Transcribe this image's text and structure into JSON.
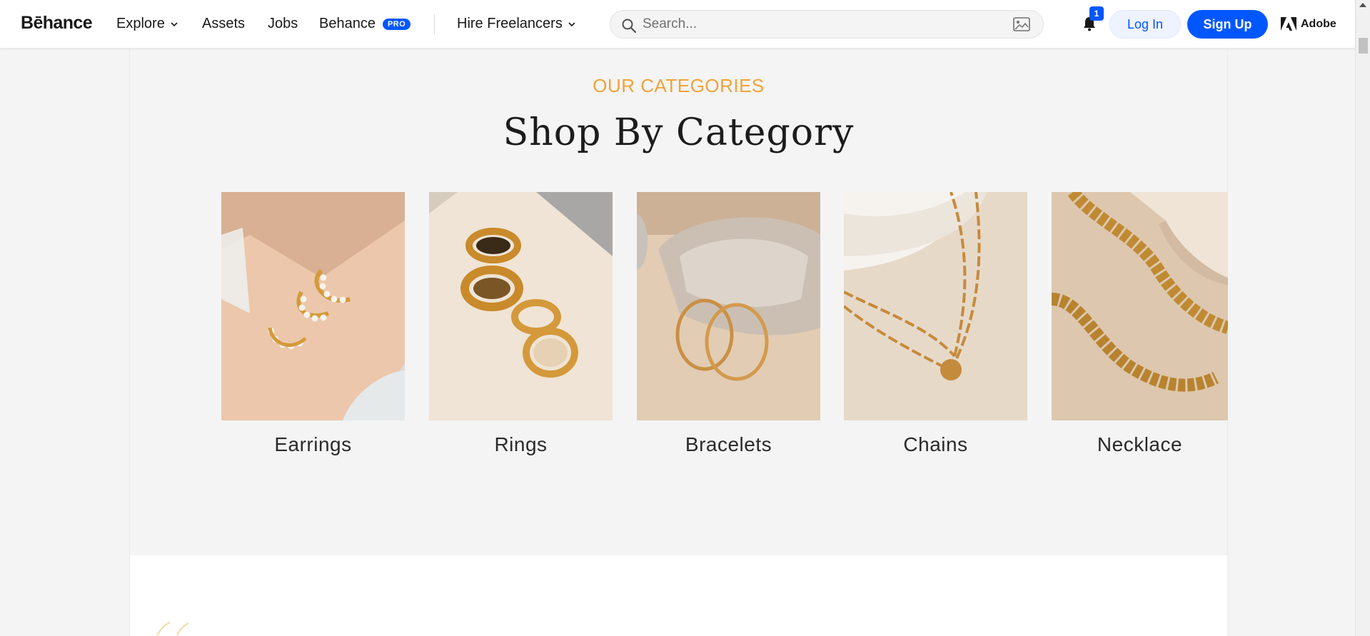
{
  "nav": {
    "logo": "Bēhance",
    "explore": "Explore",
    "assets": "Assets",
    "jobs": "Jobs",
    "behance": "Behance",
    "pro_badge": "PRO",
    "hire": "Hire Freelancers",
    "search_placeholder": "Search...",
    "notification_count": "1",
    "login": "Log In",
    "signup": "Sign Up",
    "adobe": "Adobe"
  },
  "section": {
    "eyebrow": "OUR CATEGORIES",
    "title": "Shop By Category",
    "categories": [
      {
        "label": "Earrings",
        "icon": "pearl-hoop-earrings-photo"
      },
      {
        "label": "Rings",
        "icon": "stacked-gold-rings-photo"
      },
      {
        "label": "Bracelets",
        "icon": "gold-bangles-photo"
      },
      {
        "label": "Chains",
        "icon": "paperclip-chain-photo"
      },
      {
        "label": "Necklace",
        "icon": "rope-chain-photo"
      }
    ]
  },
  "colors": {
    "accent_blue": "#0057ff",
    "eyebrow_orange": "#f2a23a",
    "page_bg": "#f4f4f4"
  }
}
